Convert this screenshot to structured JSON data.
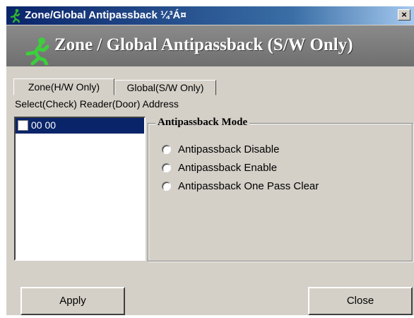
{
  "window": {
    "title": "Zone/Global Antipassback ¼³Á¤",
    "close_glyph": "×"
  },
  "banner": {
    "title": "Zone / Global Antipassback (S/W Only)"
  },
  "tabs": [
    {
      "label": "Zone(H/W Only)",
      "active": true
    },
    {
      "label": "Global(S/W Only)",
      "active": false
    }
  ],
  "zone_tab": {
    "select_label": "Select(Check) Reader(Door) Address",
    "readers": [
      {
        "label": "00 00",
        "checked": false,
        "selected": true
      }
    ],
    "mode": {
      "title": "Antipassback Mode",
      "options": [
        {
          "label": "Antipassback Disable",
          "selected": false
        },
        {
          "label": "Antipassback Enable",
          "selected": false
        },
        {
          "label": "Antipassback One Pass Clear",
          "selected": false
        }
      ]
    }
  },
  "buttons": {
    "apply": "Apply",
    "close": "Close"
  },
  "colors": {
    "titlebar": "#0a246a",
    "selection": "#0a246a",
    "banner": "#777777",
    "face": "#d4d0c8"
  },
  "icons": {
    "app": "running-man-icon",
    "banner": "running-man-icon"
  }
}
